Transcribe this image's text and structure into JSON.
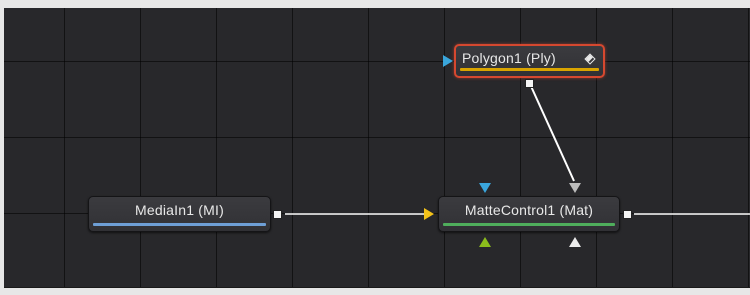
{
  "colors": {
    "background_port_blue": "#3aa6dc",
    "foreground_port_yellow": "#f3c21a",
    "effect_mask_port_green": "#8bbd1c",
    "garbage_matte_port_gray": "#bcbcbc",
    "selection_red": "#d6482f",
    "link_white": "#ffffff"
  },
  "nodes": {
    "polygon": {
      "label": "Polygon1  (Ply)",
      "bar_color": "#d9a400",
      "icon": "diamond-half-icon"
    },
    "mediain": {
      "label": "MediaIn1  (MI)",
      "bar_color": "#6e9fd6"
    },
    "mattecontrol": {
      "label": "MatteControl1  (Mat)",
      "bar_color": "#4fae5c"
    }
  }
}
